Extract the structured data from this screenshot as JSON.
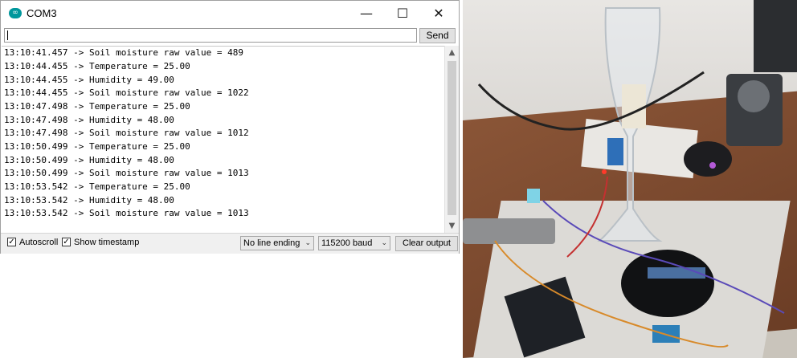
{
  "window": {
    "title": "COM3",
    "app_icon_glyph": "∞",
    "minimize_glyph": "—",
    "maximize_glyph": "☐",
    "close_glyph": "✕"
  },
  "input": {
    "value": "",
    "send_label": "Send"
  },
  "output": {
    "lines": [
      "13:10:41.457 -> Soil moisture raw value = 489",
      "13:10:44.455 -> Temperature = 25.00",
      "13:10:44.455 -> Humidity = 49.00",
      "13:10:44.455 -> Soil moisture raw value = 1022",
      "13:10:47.498 -> Temperature = 25.00",
      "13:10:47.498 -> Humidity = 48.00",
      "13:10:47.498 -> Soil moisture raw value = 1012",
      "13:10:50.499 -> Temperature = 25.00",
      "13:10:50.499 -> Humidity = 48.00",
      "13:10:50.499 -> Soil moisture raw value = 1013",
      "13:10:53.542 -> Temperature = 25.00",
      "13:10:53.542 -> Humidity = 48.00",
      "13:10:53.542 -> Soil moisture raw value = 1013"
    ]
  },
  "scrollbar": {
    "up_glyph": "▲",
    "down_glyph": "▼"
  },
  "bottom": {
    "autoscroll_label": "Autoscroll",
    "autoscroll_checked": true,
    "timestamp_label": "Show timestamp",
    "timestamp_checked": true,
    "check_glyph": "✓",
    "line_ending": "No line ending",
    "baud": "115200 baud",
    "chevron_glyph": "⌄",
    "clear_label": "Clear output"
  },
  "colors": {
    "arduino_teal": "#00979c"
  }
}
